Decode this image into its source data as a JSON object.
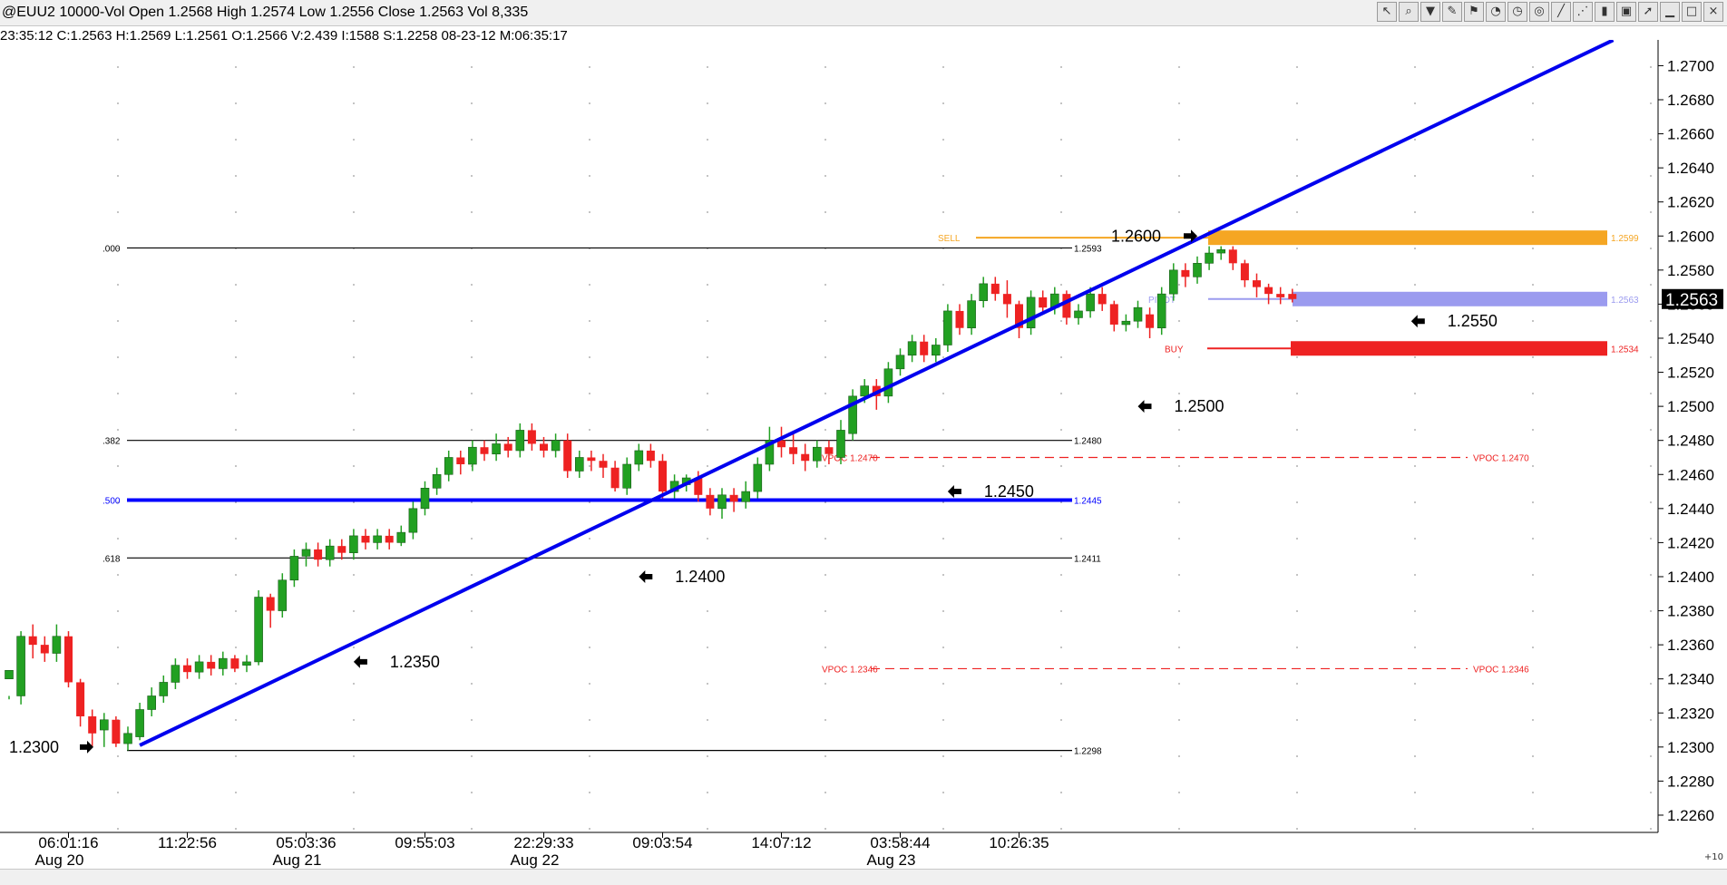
{
  "window": {
    "title": "@EUU2 10000-Vol Open 1.2568 High 1.2574 Low 1.2556 Close 1.2563 Vol 8,335",
    "info": "23:35:12  C:1.2563  H:1.2569  L:1.2561  O:1.2566  V:2.439  I:1588  S:1.2258  08-23-12  M:06:35:17",
    "corner_text": "+10"
  },
  "toolbar": [
    "pointer-icon",
    "zoom-icon",
    "filter-icon",
    "pencil-icon",
    "flag-icon",
    "gauge-icon",
    "clock-icon",
    "target-icon",
    "line-tool-icon",
    "fan-icon",
    "bars-icon",
    "trash-icon",
    "cursor-icon",
    "minimize-icon",
    "maximize-icon",
    "close-icon"
  ],
  "chart_data": {
    "type": "candlestick",
    "title": "",
    "xlabel": "",
    "ylabel": "",
    "ylim": [
      1.2252,
      1.2713
    ],
    "yticks": [
      "1.2700",
      "1.2680",
      "1.2660",
      "1.2640",
      "1.2620",
      "1.2600",
      "1.2580",
      "1.2560",
      "1.2540",
      "1.2520",
      "1.2500",
      "1.2480",
      "1.2460",
      "1.2440",
      "1.2420",
      "1.2400",
      "1.2380",
      "1.2360",
      "1.2340",
      "1.2320",
      "1.2300",
      "1.2280",
      "1.2260"
    ],
    "last_price": "1.2563",
    "time_labels": [
      {
        "time": "06:01:16",
        "date": "Aug 20",
        "bar": 5
      },
      {
        "time": "11:22:56",
        "date": "",
        "bar": 15
      },
      {
        "time": "05:03:36",
        "date": "Aug 21",
        "bar": 25
      },
      {
        "time": "09:55:03",
        "date": "",
        "bar": 35
      },
      {
        "time": "22:29:33",
        "date": "Aug 22",
        "bar": 45
      },
      {
        "time": "09:03:54",
        "date": "",
        "bar": 55
      },
      {
        "time": "14:07:12",
        "date": "",
        "bar": 65
      },
      {
        "time": "03:58:44",
        "date": "Aug 23",
        "bar": 75
      },
      {
        "time": "10:26:35",
        "date": "",
        "bar": 85
      }
    ],
    "candles": [
      [
        1.234,
        1.2345,
        1.233,
        1.2328,
        1
      ],
      [
        1.233,
        1.2365,
        1.2368,
        1.2325,
        1
      ],
      [
        1.2365,
        1.236,
        1.2372,
        1.2352,
        0
      ],
      [
        1.236,
        1.2355,
        1.2365,
        1.235,
        0
      ],
      [
        1.2355,
        1.2365,
        1.2372,
        1.235,
        1
      ],
      [
        1.2365,
        1.2338,
        1.2368,
        1.2335,
        0
      ],
      [
        1.2338,
        1.2318,
        1.234,
        1.2312,
        0
      ],
      [
        1.2318,
        1.2308,
        1.2322,
        1.23,
        0
      ],
      [
        1.231,
        1.2316,
        1.232,
        1.23,
        1
      ],
      [
        1.2316,
        1.2302,
        1.2318,
        1.23,
        0
      ],
      [
        1.2302,
        1.2308,
        1.2312,
        1.2298,
        1
      ],
      [
        1.2306,
        1.2322,
        1.2326,
        1.2304,
        1
      ],
      [
        1.2322,
        1.233,
        1.2335,
        1.2318,
        1
      ],
      [
        1.233,
        1.2338,
        1.2342,
        1.2326,
        1
      ],
      [
        1.2338,
        1.2348,
        1.2352,
        1.2334,
        1
      ],
      [
        1.2348,
        1.2344,
        1.2352,
        1.234,
        0
      ],
      [
        1.2344,
        1.235,
        1.2354,
        1.234,
        1
      ],
      [
        1.235,
        1.2346,
        1.2354,
        1.2342,
        0
      ],
      [
        1.2346,
        1.2352,
        1.2356,
        1.2342,
        1
      ],
      [
        1.2352,
        1.2346,
        1.2354,
        1.2344,
        0
      ],
      [
        1.2348,
        1.235,
        1.2354,
        1.2344,
        1
      ],
      [
        1.235,
        1.2388,
        1.2392,
        1.2348,
        1
      ],
      [
        1.2388,
        1.238,
        1.239,
        1.237,
        0
      ],
      [
        1.238,
        1.2398,
        1.2402,
        1.2376,
        1
      ],
      [
        1.2398,
        1.2412,
        1.2416,
        1.2394,
        1
      ],
      [
        1.2412,
        1.2416,
        1.242,
        1.2406,
        1
      ],
      [
        1.2416,
        1.241,
        1.242,
        1.2406,
        0
      ],
      [
        1.241,
        1.2418,
        1.2422,
        1.2406,
        1
      ],
      [
        1.2418,
        1.2414,
        1.2422,
        1.241,
        0
      ],
      [
        1.2414,
        1.2424,
        1.2428,
        1.241,
        1
      ],
      [
        1.2424,
        1.242,
        1.2428,
        1.2416,
        0
      ],
      [
        1.242,
        1.2424,
        1.2428,
        1.2416,
        1
      ],
      [
        1.2424,
        1.242,
        1.2428,
        1.2416,
        0
      ],
      [
        1.242,
        1.2426,
        1.243,
        1.2418,
        1
      ],
      [
        1.2426,
        1.244,
        1.2444,
        1.2422,
        1
      ],
      [
        1.244,
        1.2452,
        1.2456,
        1.2436,
        1
      ],
      [
        1.2452,
        1.246,
        1.2464,
        1.2448,
        1
      ],
      [
        1.246,
        1.247,
        1.2474,
        1.2456,
        1
      ],
      [
        1.247,
        1.2466,
        1.2474,
        1.246,
        0
      ],
      [
        1.2466,
        1.2476,
        1.248,
        1.2462,
        1
      ],
      [
        1.2476,
        1.2472,
        1.248,
        1.2468,
        0
      ],
      [
        1.2472,
        1.2478,
        1.2484,
        1.2468,
        1
      ],
      [
        1.2478,
        1.2474,
        1.2482,
        1.247,
        0
      ],
      [
        1.2474,
        1.2486,
        1.249,
        1.247,
        1
      ],
      [
        1.2486,
        1.2478,
        1.249,
        1.2474,
        0
      ],
      [
        1.2478,
        1.2474,
        1.2482,
        1.247,
        0
      ],
      [
        1.2474,
        1.248,
        1.2484,
        1.247,
        1
      ],
      [
        1.248,
        1.2462,
        1.2484,
        1.2458,
        0
      ],
      [
        1.2462,
        1.247,
        1.2474,
        1.2458,
        1
      ],
      [
        1.247,
        1.2468,
        1.2474,
        1.2462,
        0
      ],
      [
        1.2468,
        1.2464,
        1.2472,
        1.2458,
        0
      ],
      [
        1.2464,
        1.2452,
        1.2468,
        1.245,
        0
      ],
      [
        1.2452,
        1.2466,
        1.247,
        1.2448,
        1
      ],
      [
        1.2466,
        1.2474,
        1.2478,
        1.2462,
        1
      ],
      [
        1.2474,
        1.2468,
        1.2478,
        1.2464,
        0
      ],
      [
        1.2468,
        1.245,
        1.2472,
        1.2446,
        0
      ],
      [
        1.245,
        1.2456,
        1.246,
        1.2446,
        1
      ],
      [
        1.2454,
        1.2458,
        1.246,
        1.245,
        1
      ],
      [
        1.2458,
        1.2448,
        1.2462,
        1.2444,
        0
      ],
      [
        1.2448,
        1.244,
        1.2452,
        1.2436,
        0
      ],
      [
        1.244,
        1.2448,
        1.2452,
        1.2434,
        1
      ],
      [
        1.2448,
        1.2444,
        1.2452,
        1.2438,
        0
      ],
      [
        1.2444,
        1.245,
        1.2456,
        1.244,
        1
      ],
      [
        1.245,
        1.2466,
        1.247,
        1.2446,
        1
      ],
      [
        1.2466,
        1.248,
        1.2488,
        1.2462,
        1
      ],
      [
        1.248,
        1.2476,
        1.2488,
        1.247,
        0
      ],
      [
        1.2476,
        1.2472,
        1.2484,
        1.2466,
        0
      ],
      [
        1.2472,
        1.2468,
        1.2478,
        1.2462,
        0
      ],
      [
        1.2468,
        1.2476,
        1.248,
        1.2464,
        1
      ],
      [
        1.2476,
        1.2472,
        1.248,
        1.2466,
        0
      ],
      [
        1.247,
        1.2486,
        1.2492,
        1.2466,
        1
      ],
      [
        1.2484,
        1.2506,
        1.251,
        1.248,
        1
      ],
      [
        1.2506,
        1.2512,
        1.2516,
        1.2502,
        1
      ],
      [
        1.2512,
        1.2506,
        1.2516,
        1.2498,
        0
      ],
      [
        1.2506,
        1.2522,
        1.2526,
        1.2502,
        1
      ],
      [
        1.2522,
        1.253,
        1.2534,
        1.2518,
        1
      ],
      [
        1.253,
        1.2538,
        1.2542,
        1.2526,
        1
      ],
      [
        1.2538,
        1.253,
        1.2542,
        1.2526,
        0
      ],
      [
        1.253,
        1.2536,
        1.254,
        1.2526,
        1
      ],
      [
        1.2536,
        1.2556,
        1.256,
        1.2532,
        1
      ],
      [
        1.2556,
        1.2546,
        1.256,
        1.2542,
        0
      ],
      [
        1.2546,
        1.2562,
        1.2566,
        1.2542,
        1
      ],
      [
        1.2562,
        1.2572,
        1.2576,
        1.2558,
        1
      ],
      [
        1.2572,
        1.2566,
        1.2576,
        1.2562,
        0
      ],
      [
        1.2566,
        1.256,
        1.2574,
        1.2552,
        0
      ],
      [
        1.256,
        1.2546,
        1.2562,
        1.254,
        0
      ],
      [
        1.2546,
        1.2564,
        1.2568,
        1.2542,
        1
      ],
      [
        1.2564,
        1.2558,
        1.2568,
        1.2554,
        0
      ],
      [
        1.2558,
        1.2566,
        1.257,
        1.2554,
        1
      ],
      [
        1.2566,
        1.2552,
        1.2568,
        1.2548,
        0
      ],
      [
        1.2552,
        1.2556,
        1.256,
        1.2548,
        1
      ],
      [
        1.2556,
        1.2566,
        1.257,
        1.2552,
        1
      ],
      [
        1.2566,
        1.256,
        1.257,
        1.2556,
        0
      ],
      [
        1.256,
        1.2548,
        1.2562,
        1.2544,
        0
      ],
      [
        1.2548,
        1.255,
        1.2554,
        1.2544,
        1
      ],
      [
        1.255,
        1.2558,
        1.2562,
        1.2546,
        1
      ],
      [
        1.2554,
        1.2546,
        1.2558,
        1.254,
        0
      ],
      [
        1.2546,
        1.2566,
        1.257,
        1.2542,
        1
      ],
      [
        1.2566,
        1.258,
        1.2584,
        1.2562,
        1
      ],
      [
        1.258,
        1.2576,
        1.2584,
        1.257,
        0
      ],
      [
        1.2576,
        1.2584,
        1.2588,
        1.2572,
        1
      ],
      [
        1.2584,
        1.259,
        1.2594,
        1.258,
        1
      ],
      [
        1.259,
        1.2592,
        1.2594,
        1.2586,
        1
      ],
      [
        1.2592,
        1.2584,
        1.2594,
        1.258,
        0
      ],
      [
        1.2584,
        1.2574,
        1.2586,
        1.257,
        0
      ],
      [
        1.2574,
        1.257,
        1.2578,
        1.2564,
        0
      ],
      [
        1.257,
        1.2566,
        1.2572,
        1.256,
        0
      ],
      [
        1.2566,
        1.2564,
        1.257,
        1.256,
        0
      ],
      [
        1.2566,
        1.2563,
        1.2569,
        1.2561,
        0
      ]
    ],
    "fib_levels": [
      {
        "label": ".000",
        "value": 1.2593,
        "price_label": "1.2593",
        "color": "#000000"
      },
      {
        "label": ".382",
        "value": 1.248,
        "price_label": "1.2480",
        "color": "#000000"
      },
      {
        "label": ".500",
        "value": 1.2445,
        "price_label": "1.2445",
        "color": "#0000ff"
      },
      {
        "label": ".618",
        "value": 1.2411,
        "price_label": "1.2411",
        "color": "#000000"
      },
      {
        "label": "",
        "value": 1.2298,
        "price_label": "1.2298",
        "color": "#000000"
      }
    ],
    "zones": [
      {
        "label": "SELL",
        "value": 1.2599,
        "price_label": "1.2599",
        "color": "#f5a623"
      },
      {
        "label": "PIVOT",
        "value": 1.2563,
        "price_label": "1.2563",
        "color": "#9b9bef"
      },
      {
        "label": "BUY",
        "value": 1.2534,
        "price_label": "1.2534",
        "color": "#ee2222"
      }
    ],
    "vpoc": [
      {
        "label": "VPOC  1.2470",
        "value": 1.247
      },
      {
        "label": "VPOC 1.2346",
        "value": 1.2346
      }
    ],
    "trendline": {
      "from": [
        11,
        1.2301
      ],
      "to": [
        135,
        1.2715
      ],
      "color": "#0000ee"
    },
    "annotations": [
      {
        "text": "1.2300",
        "bar": -5,
        "value": 1.23
      },
      {
        "text": "1.2350",
        "bar": 29,
        "value": 1.235
      },
      {
        "text": "1.2400",
        "bar": 53,
        "value": 1.24
      },
      {
        "text": "1.2450",
        "bar": 79,
        "value": 1.245
      },
      {
        "text": "1.2500",
        "bar": 95,
        "value": 1.25
      },
      {
        "text": "1.2550",
        "bar": 118,
        "value": 1.255
      },
      {
        "text": "1.2600",
        "bar": 125,
        "value": 1.26
      }
    ],
    "grid": true,
    "up_color": "#22a022",
    "down_color": "#ee2222"
  }
}
